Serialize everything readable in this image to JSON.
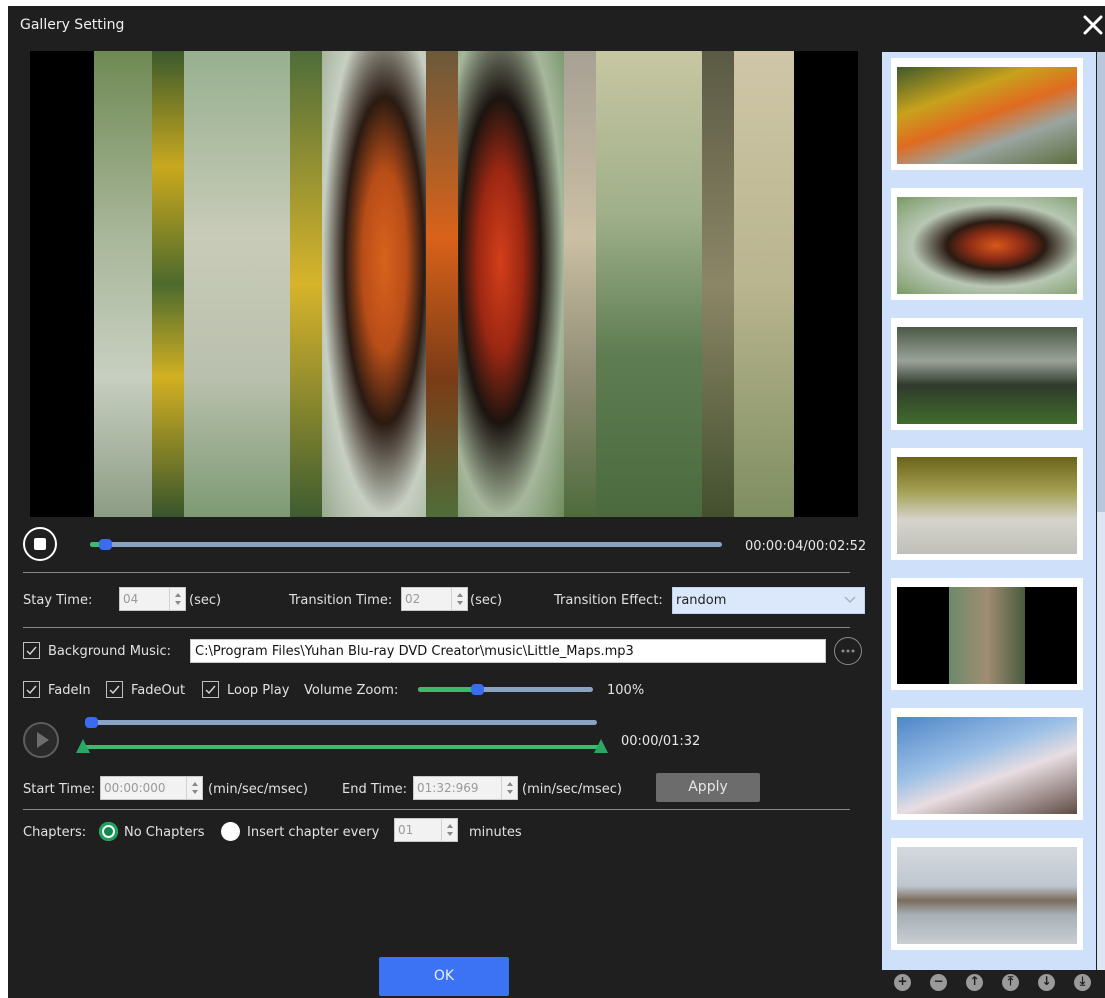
{
  "window": {
    "title": "Gallery Setting"
  },
  "icons": {
    "close": "close-icon",
    "stop": "stop-icon",
    "play": "play-icon",
    "browse": "more-icon",
    "chevron": "chevron-down-icon"
  },
  "playback": {
    "time": "00:00:04/00:02:52",
    "progress": 0.03
  },
  "stay": {
    "label": "Stay Time:",
    "value": "04",
    "unit": "(sec)"
  },
  "transition_time": {
    "label": "Transition Time:",
    "value": "02",
    "unit": "(sec)"
  },
  "transition_effect": {
    "label": "Transition Effect:",
    "value": "random"
  },
  "music": {
    "label": "Background Music:",
    "checked": true,
    "path": "C:\\Program Files\\Yuhan Blu-ray DVD Creator\\music\\Little_Maps.mp3"
  },
  "options": {
    "fadein": "FadeIn",
    "fadeout": "FadeOut",
    "loop": "Loop Play",
    "volume_label": "Volume Zoom:",
    "volume_value": "100%",
    "volume_level": 0.45
  },
  "music_player": {
    "time": "00:00/01:32",
    "progress": 0.0
  },
  "trim": {
    "start_label": "Start Time:",
    "start_value": "00:00:000",
    "start_unit": "(min/sec/msec)",
    "end_label": "End Time:",
    "end_value": "01:32:969",
    "end_unit": "(min/sec/msec)",
    "apply": "Apply"
  },
  "chapters": {
    "label": "Chapters:",
    "no_chapters": "No Chapters",
    "insert_every": "Insert chapter every",
    "interval": "01",
    "unit": "minutes"
  },
  "ok": "OK",
  "thumbnails": [
    "butterfly-flower",
    "butterfly-leaf",
    "camping-chairs",
    "white-car",
    "cat",
    "cherry-blossom",
    "harbor-town"
  ],
  "toolbar": [
    "add-icon",
    "remove-icon",
    "move-up-icon",
    "move-top-icon",
    "move-down-icon",
    "move-bottom-icon"
  ]
}
